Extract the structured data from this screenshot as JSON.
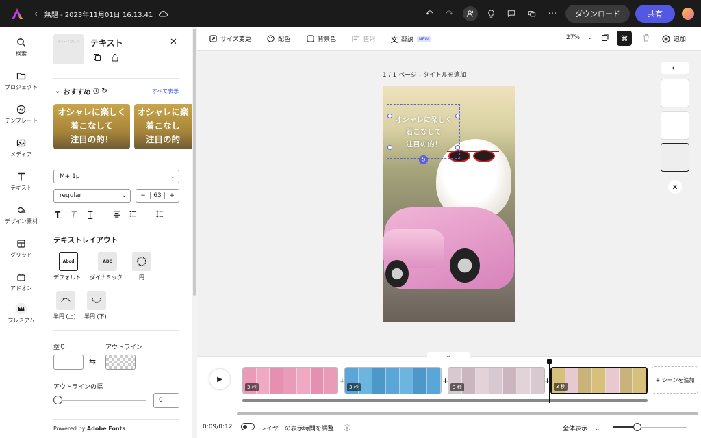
{
  "topbar": {
    "title": "無題 - 2023年11月01日 16.13.41",
    "download_label": "ダウンロード",
    "share_label": "共有",
    "icons": [
      "undo-icon",
      "redo-icon",
      "invite-user-icon",
      "lightbulb-icon",
      "comment-icon",
      "present-icon",
      "more-icon"
    ]
  },
  "nav": {
    "items": [
      {
        "label": "検索",
        "icon": "search-icon"
      },
      {
        "label": "プロジェクト",
        "icon": "folder-icon"
      },
      {
        "label": "テンプレート",
        "icon": "template-icon"
      },
      {
        "label": "メディア",
        "icon": "media-icon"
      },
      {
        "label": "テキスト",
        "icon": "text-icon"
      },
      {
        "label": "デザイン素材",
        "icon": "shapes-icon"
      },
      {
        "label": "グリッド",
        "icon": "grid-icon"
      },
      {
        "label": "アドオン",
        "icon": "addon-icon"
      },
      {
        "label": "プレミアム",
        "icon": "crown-icon"
      }
    ]
  },
  "panel": {
    "title": "テキスト",
    "recommended_label": "おすすめ",
    "see_all_label": "すべて表示",
    "rec_cards": [
      {
        "lines": [
          "オシャレに楽しく",
          "着こなして",
          "注目の的！"
        ]
      },
      {
        "lines": [
          "オシャレに楽",
          "着こなし",
          "注目の的"
        ]
      }
    ],
    "font_family": "M+ 1p",
    "font_weight": "regular",
    "font_size": "63",
    "minus": "−",
    "plus": "+",
    "text_layout_title": "テキストレイアウト",
    "layouts": [
      {
        "label": "デフォルト",
        "preview": "Abcd"
      },
      {
        "label": "ダイナミック",
        "preview": "ABC"
      },
      {
        "label": "円",
        "preview": ""
      },
      {
        "label": "半円 (上)",
        "preview": ""
      },
      {
        "label": "半円 (下)",
        "preview": ""
      }
    ],
    "fill_label": "塗り",
    "outline_label": "アウトライン",
    "outline_width_label": "アウトラインの幅",
    "outline_width_value": "0",
    "powered_by": "Powered by ",
    "powered_brand": "Adobe Fonts"
  },
  "toolbar": {
    "resize": "サイズ変更",
    "color": "配色",
    "background": "背景色",
    "align": "整列",
    "translate": "翻訳",
    "new_badge": "NEW",
    "zoom": "27%",
    "add": "追加"
  },
  "canvas": {
    "page_label": "1 / 1 ページ - タイトルを追加",
    "text_lines": [
      "オシャレに楽しく",
      "着こなして",
      "注目の的！"
    ]
  },
  "timeline": {
    "scenes": [
      {
        "duration": "3 秒",
        "colors": [
          "#e99bb8",
          "#f0a9c3",
          "#e58fb1"
        ]
      },
      {
        "duration": "3 秒",
        "colors": [
          "#5aa6d8",
          "#6cb5e0",
          "#4d97c9"
        ]
      },
      {
        "duration": "3 秒",
        "colors": [
          "#d8c8cf",
          "#cbb5bf",
          "#e3d3d8"
        ]
      },
      {
        "duration": "3 秒",
        "colors": [
          "#d6c07c",
          "#e8c9d0",
          "#c9b37a"
        ]
      }
    ],
    "add_scene": "+ シーンを追加",
    "time": "0:09/0:12",
    "toggle_label": "レイヤーの表示時間を調整",
    "zoom_label": "全体表示"
  }
}
